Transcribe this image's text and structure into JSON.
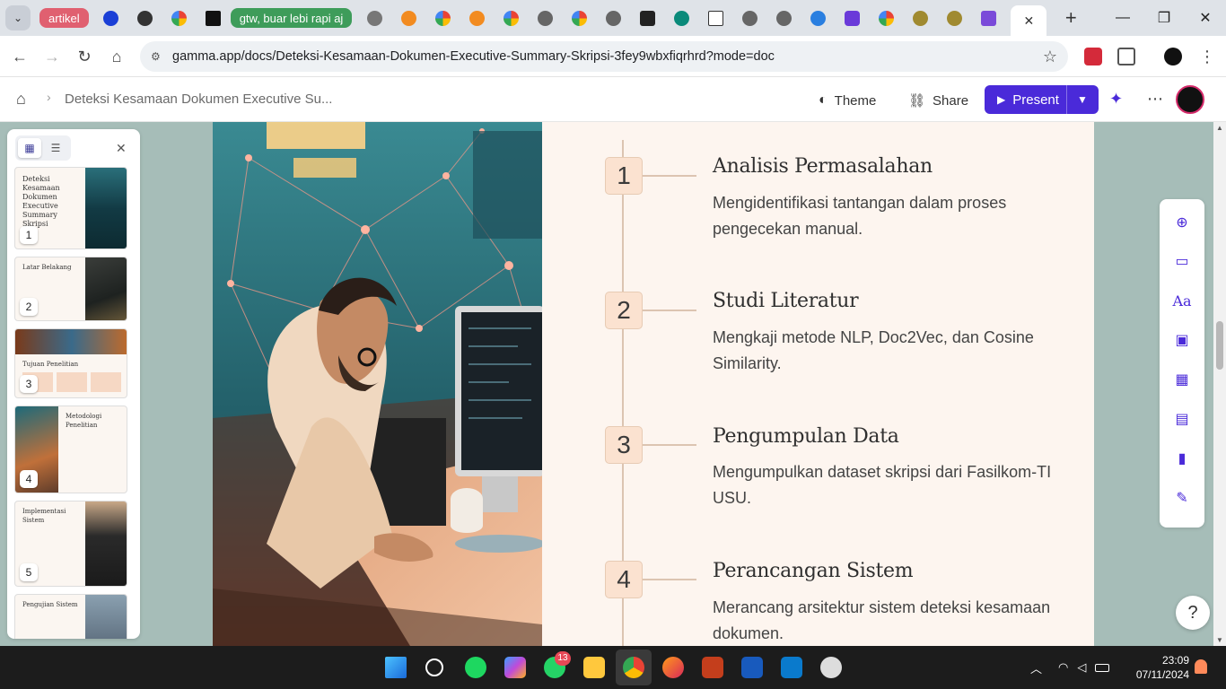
{
  "browser": {
    "tab_group_1": "artikel",
    "tab_group_2": "gtw, buar lebi rapi aj",
    "url": "gamma.app/docs/Deteksi-Kesamaan-Dokumen-Executive-Summary-Skripsi-3fey9wbxfiqrhrd?mode=doc"
  },
  "appbar": {
    "breadcrumb": "Deteksi Kesamaan Dokumen Executive Su...",
    "theme_label": "Theme",
    "share_label": "Share",
    "present_label": "Present"
  },
  "thumbnails": [
    {
      "num": "1",
      "title": "Deteksi Kesamaan Dokumen Executive Summary Skripsi"
    },
    {
      "num": "2",
      "title": "Latar Belakang"
    },
    {
      "num": "3",
      "title": "Tujuan Penelitian"
    },
    {
      "num": "4",
      "title": "Metodologi Penelitian"
    },
    {
      "num": "5",
      "title": "Implementasi Sistem"
    },
    {
      "num": "",
      "title": "Pengujian Sistem"
    }
  ],
  "steps": [
    {
      "num": "1",
      "title": "Analisis Permasalahan",
      "desc": "Mengidentifikasi tantangan dalam proses pengecekan manual."
    },
    {
      "num": "2",
      "title": "Studi Literatur",
      "desc": "Mengkaji metode NLP, Doc2Vec, dan Cosine Similarity."
    },
    {
      "num": "3",
      "title": "Pengumpulan Data",
      "desc": "Mengumpulkan dataset skripsi dari Fasilkom-TI USU."
    },
    {
      "num": "4",
      "title": "Perancangan Sistem",
      "desc": "Merancang arsitektur sistem deteksi kesamaan dokumen."
    }
  ],
  "help_label": "?",
  "taskbar": {
    "time": "23:09",
    "date": "07/11/2024",
    "whatsapp_badge": "13"
  },
  "colors": {
    "accent": "#4a2ad9",
    "workspace_bg": "#a6bdb8",
    "card_bg": "#fdf5ef",
    "step_box": "#fbe2d0"
  }
}
